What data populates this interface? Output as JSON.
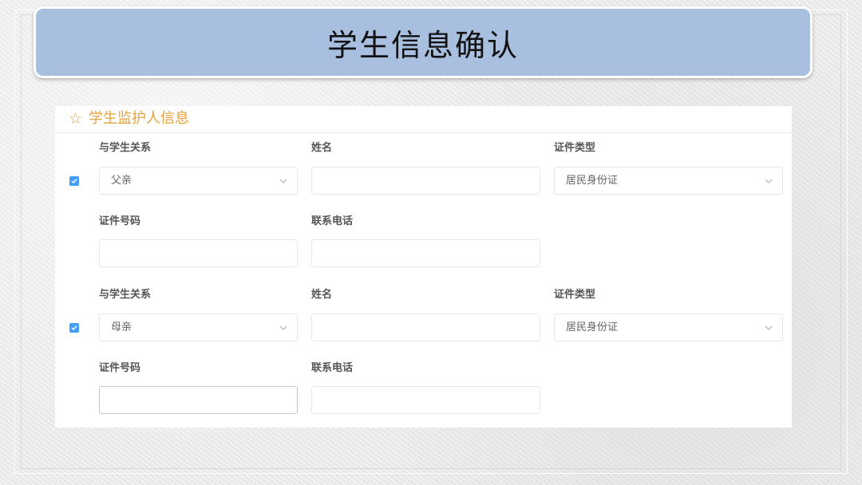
{
  "page": {
    "title": "学生信息确认"
  },
  "section": {
    "title": "学生监护人信息",
    "icon": "star-outline-icon",
    "accent_color": "#e6a23c"
  },
  "guardians": [
    {
      "checked": true,
      "relation_label": "与学生关系",
      "relation_value": "父亲",
      "name_label": "姓名",
      "name_value": "",
      "id_type_label": "证件类型",
      "id_type_value": "居民身份证",
      "id_number_label": "证件号码",
      "id_number_value": "",
      "phone_label": "联系电话",
      "phone_value": ""
    },
    {
      "checked": true,
      "relation_label": "与学生关系",
      "relation_value": "母亲",
      "name_label": "姓名",
      "name_value": "",
      "id_type_label": "证件类型",
      "id_type_value": "居民身份证",
      "id_number_label": "证件号码",
      "id_number_value": "",
      "phone_label": "联系电话",
      "phone_value": ""
    }
  ],
  "colors": {
    "banner": "#a9bfe0",
    "checkbox": "#409eff",
    "label": "#555555"
  }
}
